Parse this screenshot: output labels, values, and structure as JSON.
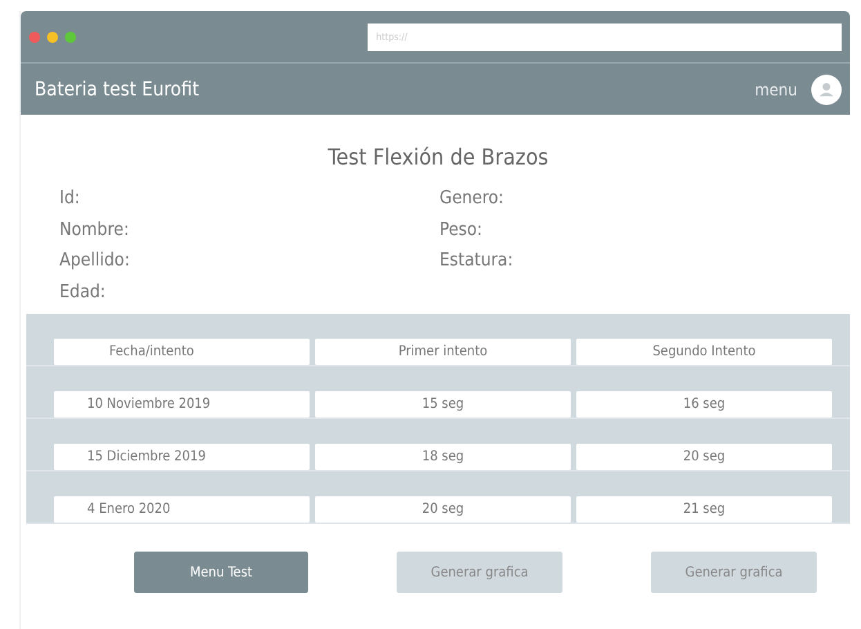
{
  "browser": {
    "address_placeholder": "https://"
  },
  "app_bar": {
    "title": "Bateria test Eurofit",
    "menu": "menu"
  },
  "page_title": "Test Flexión de Brazos",
  "fields_left": [
    "Id:",
    "Nombre:",
    "Apellido:",
    "Edad:"
  ],
  "fields_right": [
    "Genero:",
    "Peso:",
    "Estatura:"
  ],
  "table": {
    "columns": [
      "Fecha/intento",
      "Primer intento",
      "Segundo Intento"
    ],
    "rows": [
      [
        "10 Noviembre 2019",
        "15 seg",
        "16  seg"
      ],
      [
        "15 Diciembre 2019",
        "18 seg",
        "20 seg"
      ],
      [
        "4 Enero 2020",
        "20 seg",
        "21 seg"
      ]
    ]
  },
  "buttons": [
    {
      "label": "Menu Test",
      "kind": "primary"
    },
    {
      "label": "Generar grafica",
      "kind": "secondary"
    },
    {
      "label": "Generar grafica",
      "kind": "secondary"
    }
  ]
}
